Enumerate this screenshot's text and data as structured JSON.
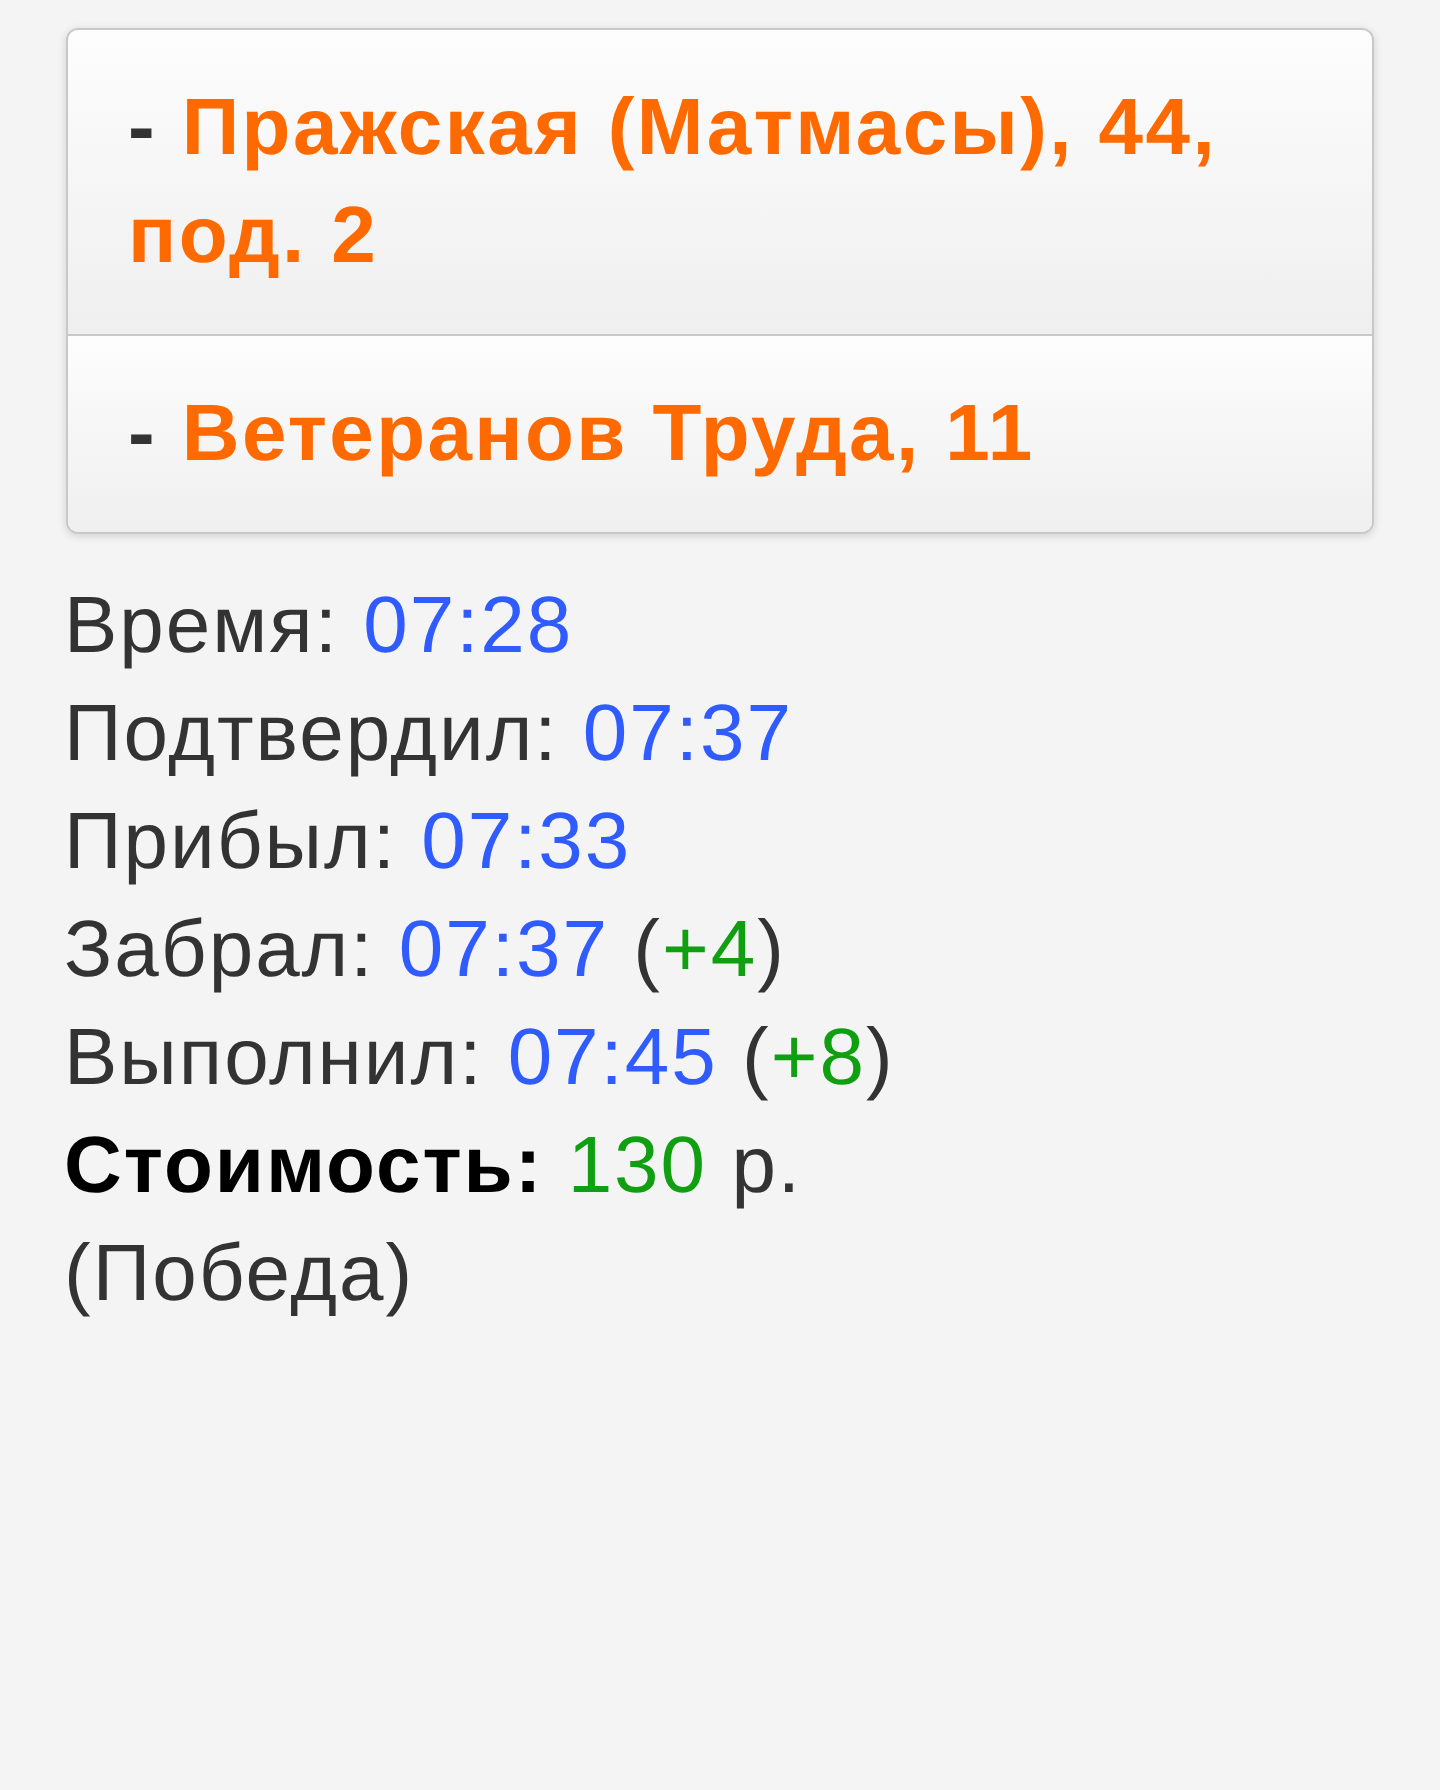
{
  "addresses": [
    {
      "marker": "-",
      "text": "Пражская (Матмасы), 44, под. 2"
    },
    {
      "marker": "-",
      "text": "Ветеранов Труда, 11"
    }
  ],
  "details": [
    {
      "label": "Время:",
      "time": "07:28"
    },
    {
      "label": "Подтвердил:",
      "time": "07:37"
    },
    {
      "label": "Прибыл:",
      "time": "07:33"
    },
    {
      "label": "Забрал:",
      "time": "07:37",
      "delta": {
        "open": "(",
        "value": "+4",
        "close": ")"
      }
    },
    {
      "label": "Выполнил:",
      "time": "07:45",
      "delta": {
        "open": "(",
        "value": "+8",
        "close": ")"
      }
    }
  ],
  "cost": {
    "label": "Стоимость:",
    "amount": "130",
    "unit": "р.",
    "note": "(Победа)"
  }
}
